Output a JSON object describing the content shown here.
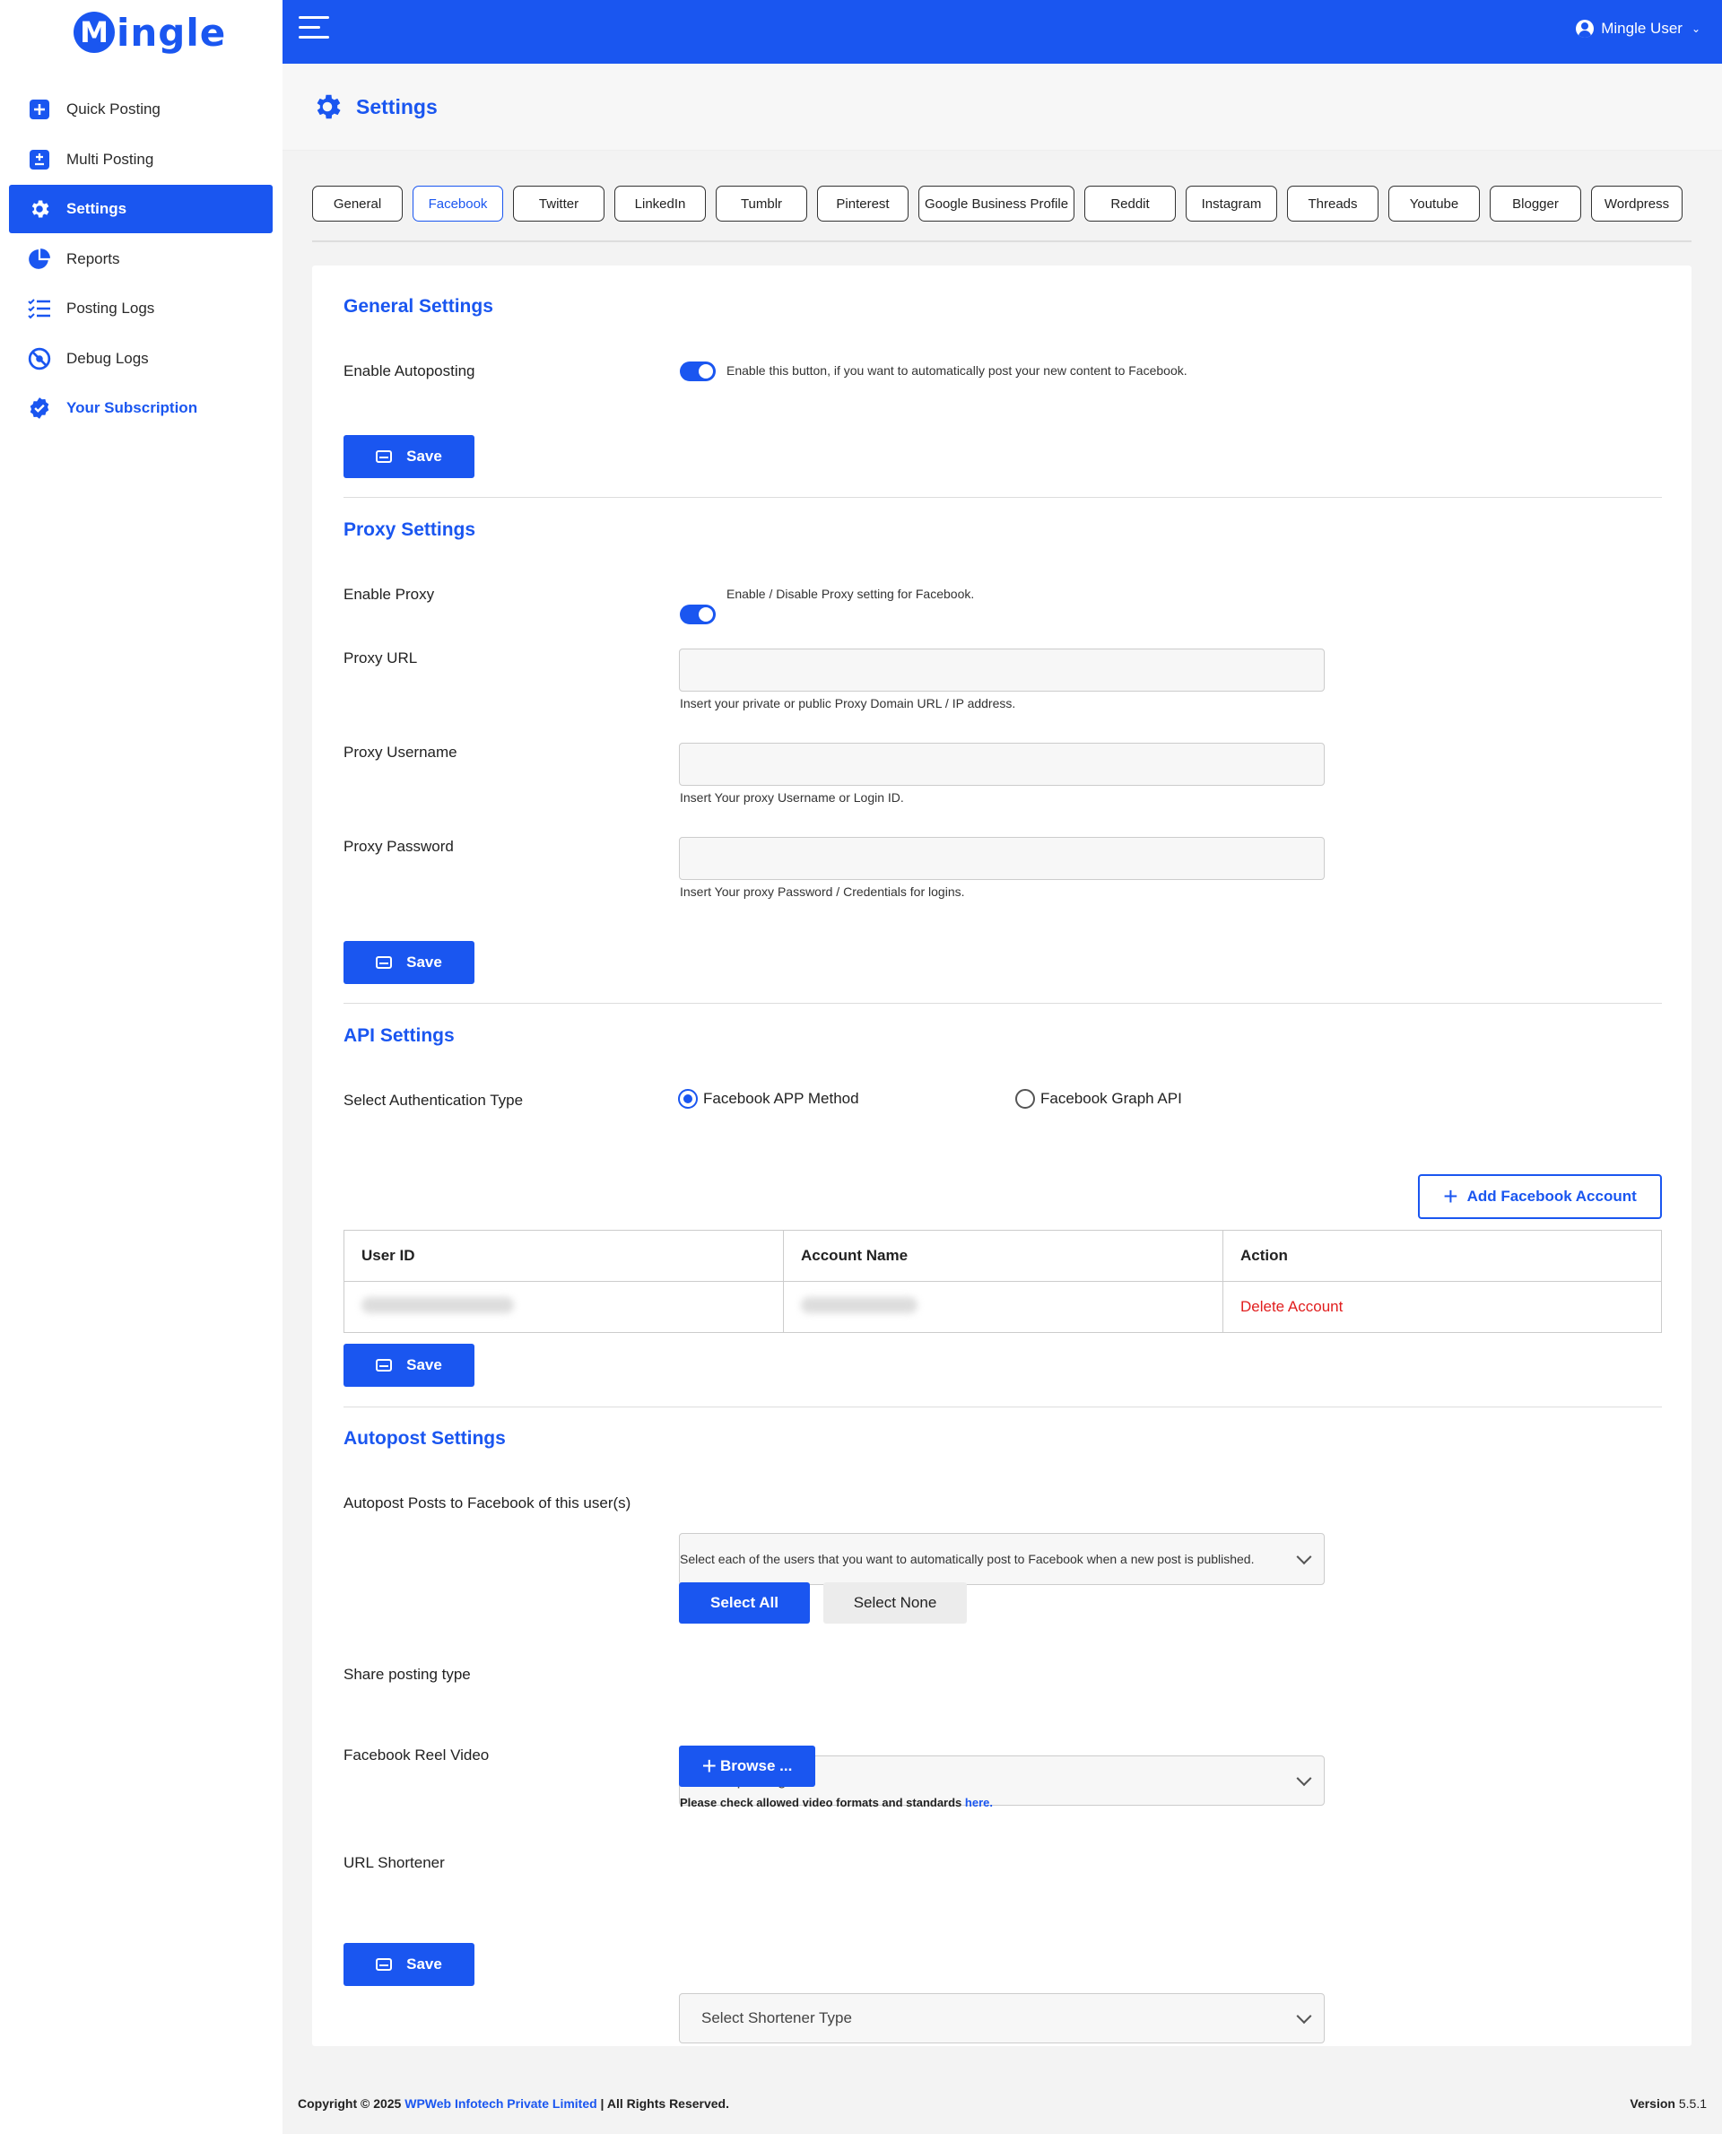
{
  "brand": {
    "logo_letter": "M",
    "logo_text": "ingle"
  },
  "sidebar": {
    "items": [
      {
        "label": "Quick Posting",
        "icon": "plus-square-icon"
      },
      {
        "label": "Multi Posting",
        "icon": "plus-minus-square-icon"
      },
      {
        "label": "Settings",
        "icon": "gear-icon",
        "active": true
      },
      {
        "label": "Reports",
        "icon": "pie-chart-icon"
      },
      {
        "label": "Posting Logs",
        "icon": "checklist-icon"
      },
      {
        "label": "Debug Logs",
        "icon": "bug-icon"
      },
      {
        "label": "Your Subscription",
        "icon": "verified-badge-icon"
      }
    ]
  },
  "topbar": {
    "user_name": "Mingle User"
  },
  "page": {
    "title": "Settings"
  },
  "tabs": [
    {
      "label": "General"
    },
    {
      "label": "Facebook",
      "active": true
    },
    {
      "label": "Twitter"
    },
    {
      "label": "LinkedIn"
    },
    {
      "label": "Tumblr"
    },
    {
      "label": "Pinterest"
    },
    {
      "label": "Google Business Profile"
    },
    {
      "label": "Reddit"
    },
    {
      "label": "Instagram"
    },
    {
      "label": "Threads"
    },
    {
      "label": "Youtube"
    },
    {
      "label": "Blogger"
    },
    {
      "label": "Wordpress"
    }
  ],
  "general_settings": {
    "title": "General Settings",
    "enable_autoposting_label": "Enable Autoposting",
    "enable_autoposting_hint": "Enable this button, if you want to automatically post your new content to Facebook.",
    "enable_autoposting_on": true,
    "save_label": "Save"
  },
  "proxy_settings": {
    "title": "Proxy Settings",
    "enable_proxy_label": "Enable Proxy",
    "enable_proxy_hint": "Enable / Disable Proxy setting for Facebook.",
    "enable_proxy_on": true,
    "proxy_url_label": "Proxy URL",
    "proxy_url_value": "",
    "proxy_url_hint": "Insert your private or public Proxy Domain URL / IP address.",
    "proxy_username_label": "Proxy Username",
    "proxy_username_value": "",
    "proxy_username_hint": "Insert Your proxy Username or Login ID.",
    "proxy_password_label": "Proxy Password",
    "proxy_password_value": "",
    "proxy_password_hint": "Insert Your proxy Password / Credentials for logins.",
    "save_label": "Save"
  },
  "api_settings": {
    "title": "API Settings",
    "auth_type_label": "Select Authentication Type",
    "auth_options": [
      {
        "label": "Facebook APP Method",
        "selected": true
      },
      {
        "label": "Facebook Graph API",
        "selected": false
      }
    ],
    "add_account_label": "Add Facebook Account",
    "table": {
      "headers": [
        "User ID",
        "Account Name",
        "Action"
      ],
      "rows": [
        {
          "action": "Delete Account"
        }
      ]
    },
    "save_label": "Save"
  },
  "autopost_settings": {
    "title": "Autopost Settings",
    "users_label": "Autopost Posts to Facebook of this user(s)",
    "users_value": "",
    "users_hint": "Select each of the users that you want to automatically post to Facebook when a new post is published.",
    "select_all_label": "Select All",
    "select_none_label": "Select None",
    "share_type_label": "Share posting type",
    "share_type_value": "Reel posting",
    "reel_video_label": "Facebook Reel Video",
    "browse_label": "Browse ...",
    "reel_hint": "Please check allowed video formats and standards ",
    "reel_hint_link": "here.",
    "shortener_label": "URL Shortener",
    "shortener_value": "Select Shortener Type",
    "save_label": "Save"
  },
  "footer": {
    "copyright_prefix": "Copyright © 2025 ",
    "company": "WPWeb Infotech Private Limited",
    "copyright_suffix": " | All Rights Reserved.",
    "version_label": "Version",
    "version_value": "5.5.1"
  },
  "colors": {
    "primary": "#1a56f0",
    "danger": "#e11d1d"
  }
}
